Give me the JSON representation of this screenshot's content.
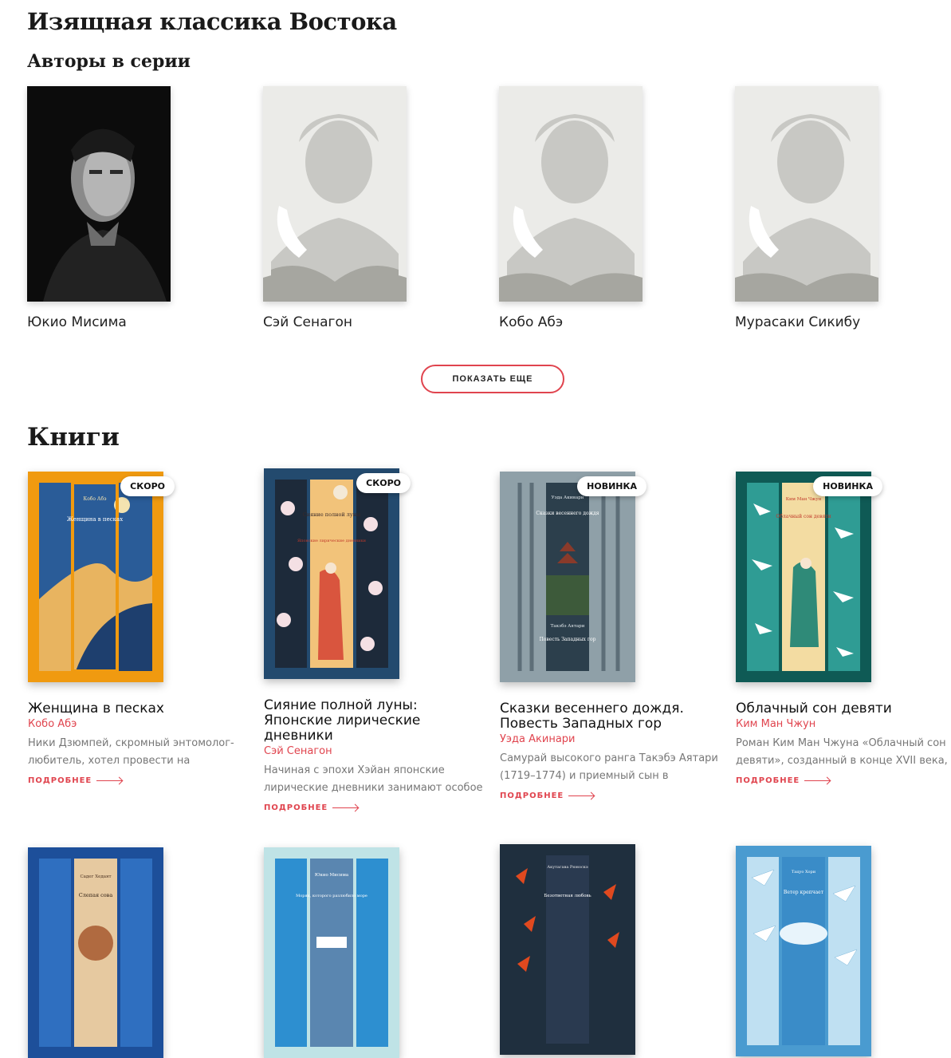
{
  "page": {
    "title": "Изящная классика Востока",
    "authors_heading": "Авторы в серии",
    "show_more_label": "ПОКАЗАТЬ ЕЩЕ",
    "books_heading": "Книги"
  },
  "authors": [
    {
      "name": "Юкио Мисима",
      "photo": "photo"
    },
    {
      "name": "Сэй Сенагон",
      "photo": "placeholder"
    },
    {
      "name": "Кобо Абэ",
      "photo": "placeholder"
    },
    {
      "name": "Мурасаки Сикибу",
      "photo": "placeholder"
    }
  ],
  "books": [
    {
      "title": "Женщина в песках",
      "author": "Кобо Абэ",
      "badge": "СКОРО",
      "desc": "Ники Дзюмпей, скромный энтомолог-любитель, хотел провести на побережье",
      "more": "ПОДРОБНЕЕ",
      "cover_author": "Кобо Абэ",
      "cover_title": "Женщина в песках",
      "cover_bg": "#f09a10"
    },
    {
      "title": "Сияние полной луны: Японские лирические дневники",
      "author": "Сэй Сенагон",
      "badge": "СКОРО",
      "desc": "Начиная с эпохи Хэйан японские лирические дневники занимают особое",
      "more": "ПОДРОБНЕЕ",
      "cover_author": "",
      "cover_title": "Сияние полной луны",
      "cover_sub": "Японские лирические дневники",
      "cover_bg": "#234a6e"
    },
    {
      "title": "Сказки весеннего дождя. Повесть Западных гор",
      "author": "Уэда Акинари",
      "badge": "НОВИНКА",
      "desc": "Самурай высокого ранга Такэбэ Аятари (1719–1774) и приемный сын в",
      "more": "ПОДРОБНЕЕ",
      "cover_author": "Уэда Акинари",
      "cover_title": "Сказки весеннего дождя",
      "cover_author2": "Такэбэ Аятари",
      "cover_title2": "Повесть Западных гор",
      "cover_bg": "#8fa0a8"
    },
    {
      "title": "Облачный сон девяти",
      "author": "Ким Ман Чжун",
      "badge": "НОВИНКА",
      "desc": "Роман Ким Ман Чжуна «Облачный сон девяти», созданный в конце XVII века,",
      "more": "ПОДРОБНЕЕ",
      "cover_author": "Ким Ман Чжун",
      "cover_title": "Облачный сон девяти",
      "cover_bg": "#0f5a55"
    }
  ],
  "books_row2": [
    {
      "cover_author": "Садег Хедаят",
      "cover_title": "Слепая сова",
      "cover_bg": "#1d4f9a"
    },
    {
      "cover_author": "Юкио Мисима",
      "cover_title": "Моряк, которого разлюбило море",
      "cover_bg": "#bfe3e6"
    },
    {
      "cover_author": "Акутагава Рюноскэ",
      "cover_title": "Безответная любовь",
      "cover_bg": "#1f2f3e"
    },
    {
      "cover_author": "Тацуо Хори",
      "cover_title": "Ветер крепчает",
      "cover_bg": "#4a9bd0"
    }
  ]
}
